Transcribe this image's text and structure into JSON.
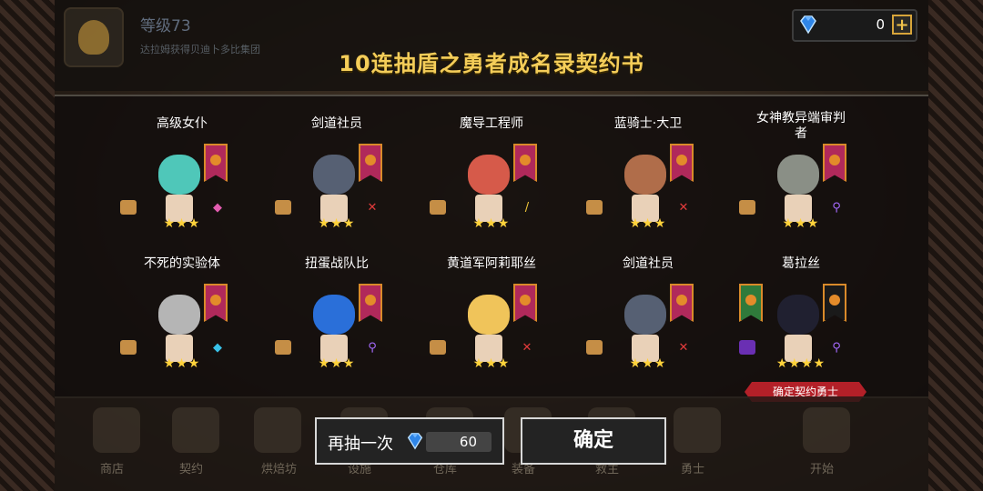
{
  "header": {
    "level": "等级73",
    "level_sub": "达拉姆获得贝迪卜多比集团",
    "gem_count": "0",
    "plus": "+"
  },
  "title": "10连抽盾之勇者成名录契约书",
  "cards": [
    {
      "name": "高级女仆",
      "stars": "★★★",
      "weapon": "◆",
      "color": "#4fc7b9",
      "weapon_color": "#e35cb0"
    },
    {
      "name": "剑道社员",
      "stars": "★★★",
      "weapon": "✕",
      "color": "#566073",
      "weapon_color": "#e23b3b"
    },
    {
      "name": "魔导工程师",
      "stars": "★★★",
      "weapon": "/",
      "color": "#d65a4a",
      "weapon_color": "#f0c73a"
    },
    {
      "name": "蓝骑士·大卫",
      "stars": "★★★",
      "weapon": "✕",
      "color": "#b06d4a",
      "weapon_color": "#e23b3b"
    },
    {
      "name": "女神教异端审判者",
      "stars": "★★★",
      "weapon": "⚲",
      "color": "#8a8f86",
      "weapon_color": "#a66bff"
    },
    {
      "name": "不死的实验体",
      "stars": "★★★",
      "weapon": "◆",
      "color": "#b5b5b5",
      "weapon_color": "#39c2e8"
    },
    {
      "name": "扭蛋战队比",
      "stars": "★★★",
      "weapon": "⚲",
      "color": "#2a6fd9",
      "weapon_color": "#a66bff"
    },
    {
      "name": "黄道军阿莉耶丝",
      "stars": "★★★",
      "weapon": "✕",
      "color": "#f0c45a",
      "weapon_color": "#e23b3b"
    },
    {
      "name": "剑道社员",
      "stars": "★★★",
      "weapon": "✕",
      "color": "#566073",
      "weapon_color": "#e23b3b"
    },
    {
      "name": "葛拉丝",
      "stars": "★★★★",
      "weapon": "⚲",
      "color": "#202030",
      "weapon_color": "#a66bff"
    }
  ],
  "confirm_tag": "确定契约勇士",
  "bottom_nav": [
    "商店",
    "契约",
    "烘焙坊",
    "设施",
    "仓库",
    "装备",
    "救主",
    "勇士",
    "开始"
  ],
  "buttons": {
    "redo_label": "再抽一次",
    "redo_cost": "60",
    "ok_label": "确定"
  }
}
